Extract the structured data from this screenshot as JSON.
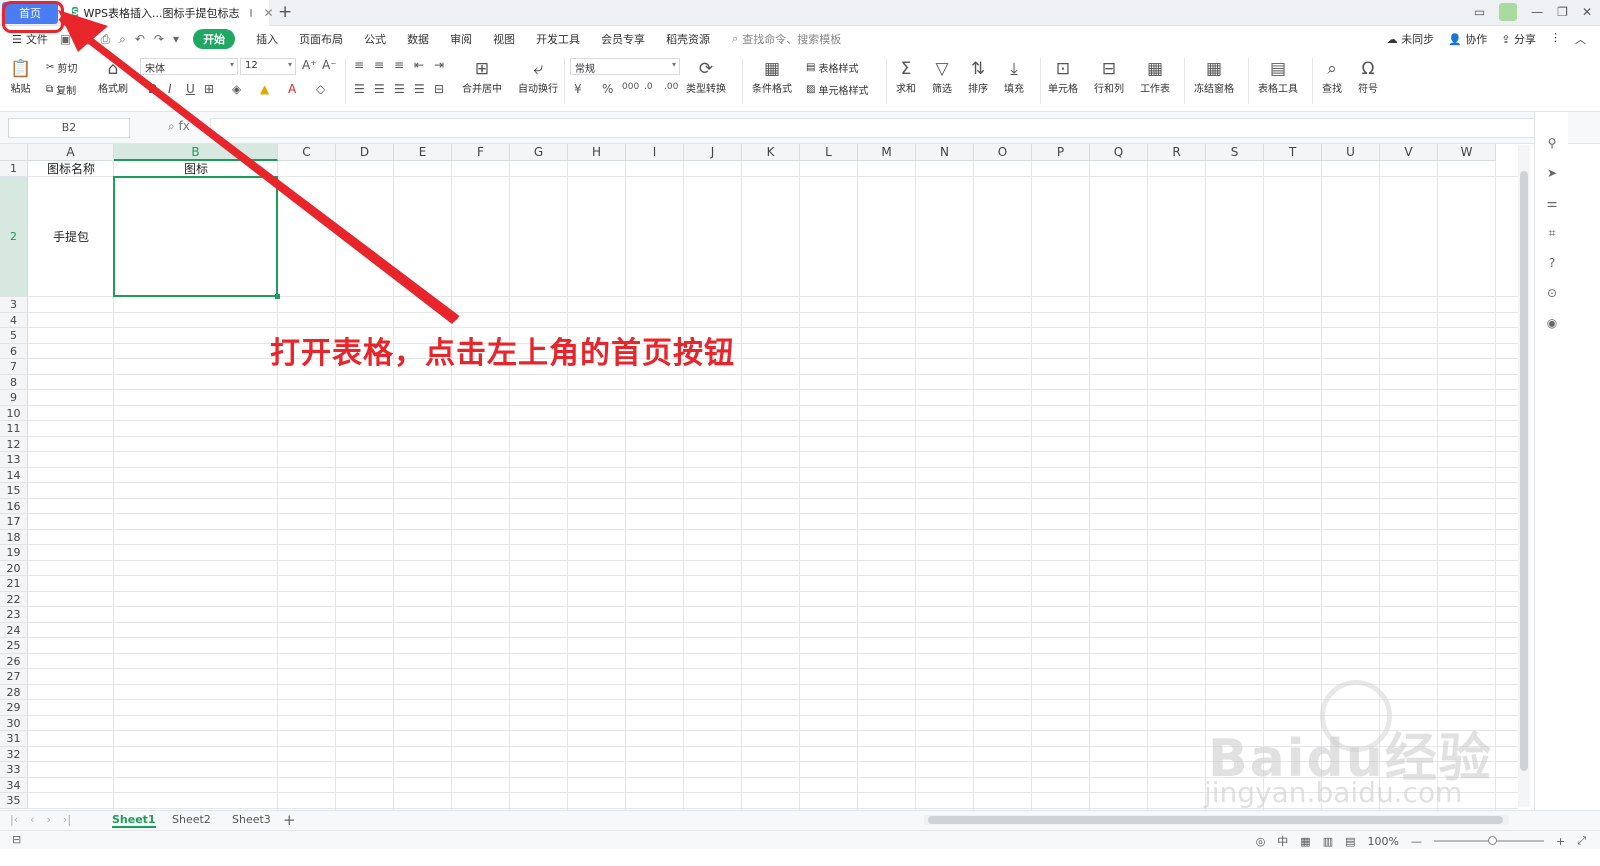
{
  "titlebar": {
    "home_tab": "首页",
    "doc_icon": "S",
    "doc_title": "WPS表格插入...图标手提包标志"
  },
  "menubar": {
    "file_label": "文件",
    "tabs": [
      "开始",
      "插入",
      "页面布局",
      "公式",
      "数据",
      "审阅",
      "视图",
      "开发工具",
      "会员专享",
      "稻壳资源"
    ],
    "active_tab": "开始",
    "search_placeholder": "查找命令、搜索模板",
    "sync_label": "未同步",
    "collab_label": "协作",
    "share_label": "分享"
  },
  "ribbon": {
    "paste": "粘贴",
    "cut": "剪切",
    "copy": "复制",
    "format_painter": "格式刷",
    "font_name": "宋体",
    "font_size": "12",
    "merge_center": "合并居中",
    "auto_wrap": "自动换行",
    "number_format": "常规",
    "type_convert": "类型转换",
    "cond_format": "条件格式",
    "table_style": "表格样式",
    "cell_style": "单元格样式",
    "sum": "求和",
    "filter": "筛选",
    "sort": "排序",
    "fill": "填充",
    "cell": "单元格",
    "row_col": "行和列",
    "worksheet": "工作表",
    "freeze": "冻结窗格",
    "table_tools": "表格工具",
    "find": "查找",
    "symbol": "符号"
  },
  "formulabar": {
    "name_box": "B2",
    "fx_label": "fx",
    "value": ""
  },
  "sheet": {
    "columns": [
      "A",
      "B",
      "C",
      "D",
      "E",
      "F",
      "G",
      "H",
      "I",
      "J",
      "K",
      "L",
      "M",
      "N",
      "O",
      "P",
      "Q",
      "R",
      "S",
      "T",
      "U",
      "V",
      "W"
    ],
    "rows": [
      "1",
      "2",
      "3",
      "4",
      "5",
      "6",
      "7",
      "8",
      "9",
      "10",
      "11",
      "12",
      "13",
      "14",
      "15",
      "16",
      "17",
      "18",
      "19",
      "20",
      "21",
      "22",
      "23",
      "24",
      "25",
      "26",
      "27",
      "28",
      "29",
      "30",
      "31",
      "32",
      "33",
      "34",
      "35"
    ],
    "selected_column": "B",
    "selected_row": "2",
    "a1": "图标名称",
    "b1": "图标",
    "a2": "手提包"
  },
  "sheet_tabs": [
    "Sheet1",
    "Sheet2",
    "Sheet3"
  ],
  "active_sheet": "Sheet1",
  "status": {
    "zoom": "100%",
    "input_mode": "中"
  },
  "annotation": {
    "text": "打开表格，点击左上角的首页按钮",
    "color": "#e8252b"
  },
  "watermark": {
    "brand": "Baidu经验",
    "url": "jingyan.baidu.com"
  },
  "colors": {
    "accent_green": "#1e9c5a",
    "home_tab_blue": "#4a7cf3"
  }
}
